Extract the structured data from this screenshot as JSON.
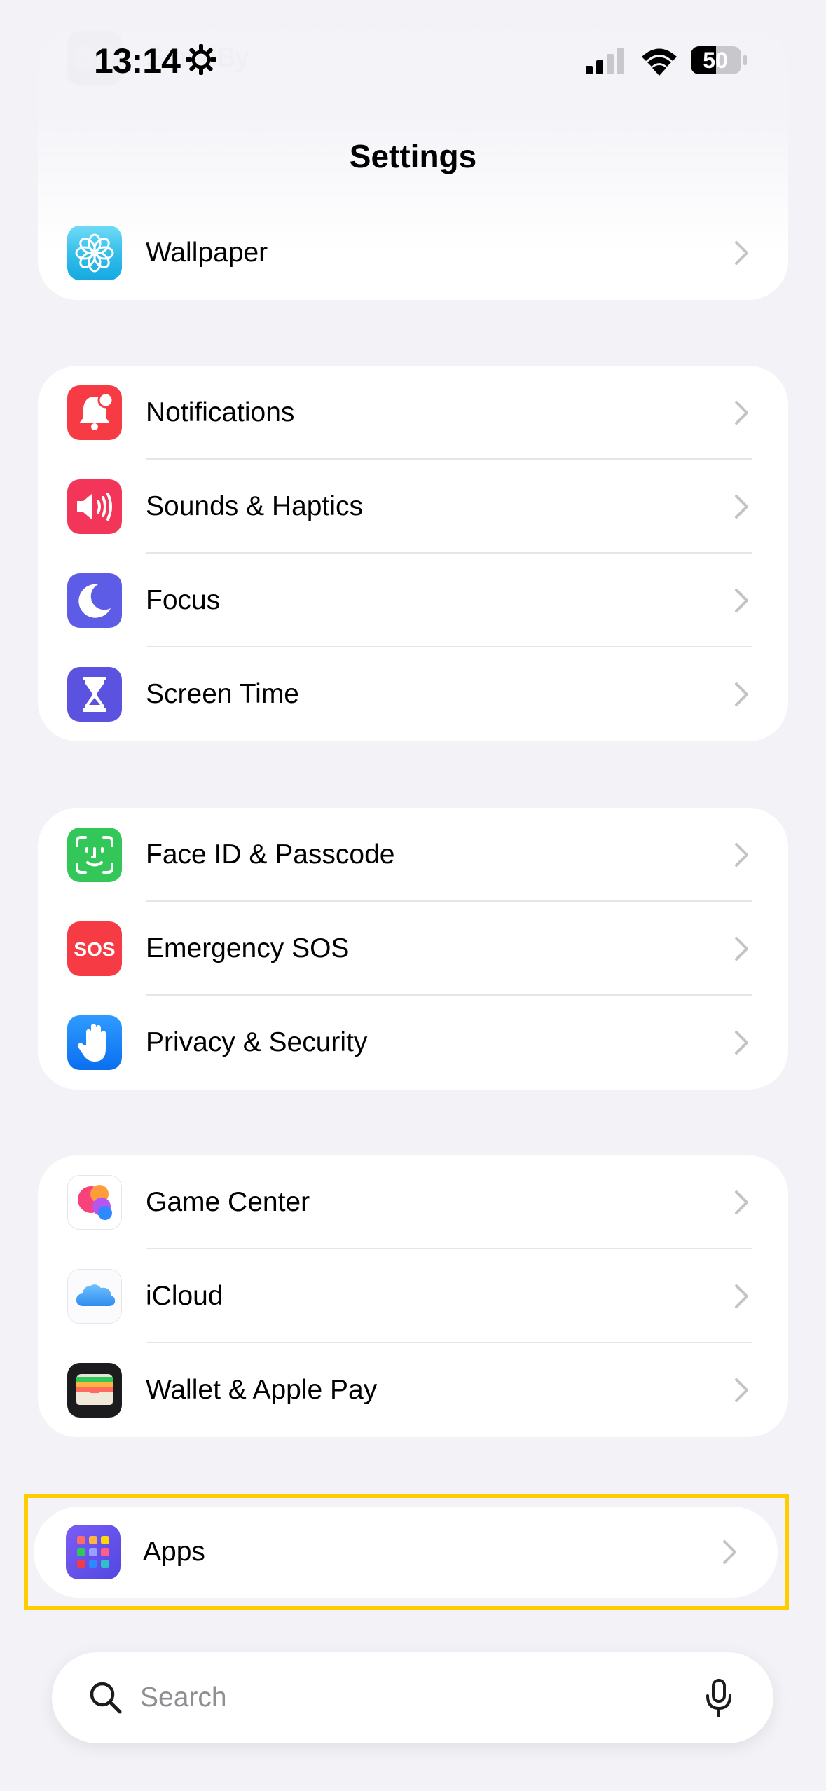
{
  "status": {
    "time": "13:14",
    "battery": "50"
  },
  "nav": {
    "title": "Settings"
  },
  "group0": [
    {
      "label": "StandBy",
      "icon": "standby-icon"
    },
    {
      "label": "Wallpaper",
      "icon": "wallpaper-icon"
    }
  ],
  "group1": [
    {
      "label": "Notifications",
      "icon": "notifications-icon"
    },
    {
      "label": "Sounds & Haptics",
      "icon": "sounds-icon"
    },
    {
      "label": "Focus",
      "icon": "focus-icon"
    },
    {
      "label": "Screen Time",
      "icon": "screen-time-icon"
    }
  ],
  "group2": [
    {
      "label": "Face ID & Passcode",
      "icon": "face-id-icon"
    },
    {
      "label": "Emergency SOS",
      "icon": "sos-icon",
      "badge": "SOS"
    },
    {
      "label": "Privacy & Security",
      "icon": "privacy-hand-icon"
    }
  ],
  "group3": [
    {
      "label": "Game Center",
      "icon": "game-center-icon"
    },
    {
      "label": "iCloud",
      "icon": "icloud-icon"
    },
    {
      "label": "Wallet & Apple Pay",
      "icon": "wallet-icon"
    }
  ],
  "apps": {
    "label": "Apps",
    "icon": "apps-grid-icon"
  },
  "search": {
    "placeholder": "Search"
  },
  "colors": {
    "highlight": "#ffcc00",
    "background": "#f2f2f7",
    "chevron": "#c4c4c7"
  }
}
